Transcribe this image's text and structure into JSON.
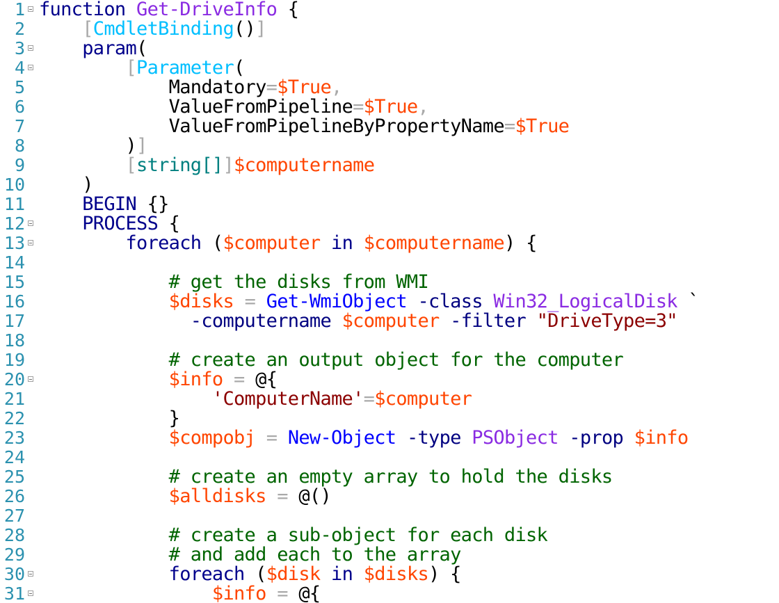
{
  "editor": {
    "language": "PowerShell",
    "token_colors": {
      "keyword": "#00008b",
      "function": "#8a2be2",
      "attribute": "#00bfff",
      "type": "#008080",
      "variable": "#ff4500",
      "operator": "#a9a9a9",
      "param": "#000080",
      "command": "#0000ff",
      "comment": "#006400",
      "string": "#8b0000",
      "text": "#000000",
      "line_number": "#2b91af"
    },
    "lines": [
      {
        "num": "1",
        "fold": true,
        "tokens": [
          {
            "t": "keyword",
            "v": "function"
          },
          {
            "t": "text",
            "v": " "
          },
          {
            "t": "function",
            "v": "Get-DriveInfo"
          },
          {
            "t": "text",
            "v": " {"
          }
        ]
      },
      {
        "num": "2",
        "fold": false,
        "tokens": [
          {
            "t": "text",
            "v": "    "
          },
          {
            "t": "operator",
            "v": "["
          },
          {
            "t": "attribute",
            "v": "CmdletBinding"
          },
          {
            "t": "text",
            "v": "()"
          },
          {
            "t": "operator",
            "v": "]"
          }
        ]
      },
      {
        "num": "3",
        "fold": true,
        "tokens": [
          {
            "t": "text",
            "v": "    "
          },
          {
            "t": "keyword",
            "v": "param"
          },
          {
            "t": "text",
            "v": "("
          }
        ]
      },
      {
        "num": "4",
        "fold": true,
        "tokens": [
          {
            "t": "text",
            "v": "        "
          },
          {
            "t": "operator",
            "v": "["
          },
          {
            "t": "attribute",
            "v": "Parameter"
          },
          {
            "t": "text",
            "v": "("
          }
        ]
      },
      {
        "num": "5",
        "fold": false,
        "tokens": [
          {
            "t": "text",
            "v": "            Mandatory"
          },
          {
            "t": "operator",
            "v": "="
          },
          {
            "t": "variable",
            "v": "$True"
          },
          {
            "t": "operator",
            "v": ","
          }
        ]
      },
      {
        "num": "6",
        "fold": false,
        "tokens": [
          {
            "t": "text",
            "v": "            ValueFromPipeline"
          },
          {
            "t": "operator",
            "v": "="
          },
          {
            "t": "variable",
            "v": "$True"
          },
          {
            "t": "operator",
            "v": ","
          }
        ]
      },
      {
        "num": "7",
        "fold": false,
        "tokens": [
          {
            "t": "text",
            "v": "            ValueFromPipelineByPropertyName"
          },
          {
            "t": "operator",
            "v": "="
          },
          {
            "t": "variable",
            "v": "$True"
          }
        ]
      },
      {
        "num": "8",
        "fold": false,
        "tokens": [
          {
            "t": "text",
            "v": "        )"
          },
          {
            "t": "operator",
            "v": "]"
          }
        ]
      },
      {
        "num": "9",
        "fold": false,
        "tokens": [
          {
            "t": "text",
            "v": "        "
          },
          {
            "t": "operator",
            "v": "["
          },
          {
            "t": "type",
            "v": "string[]"
          },
          {
            "t": "operator",
            "v": "]"
          },
          {
            "t": "variable",
            "v": "$computername"
          }
        ]
      },
      {
        "num": "10",
        "fold": false,
        "tokens": [
          {
            "t": "text",
            "v": "    )"
          }
        ]
      },
      {
        "num": "11",
        "fold": false,
        "tokens": [
          {
            "t": "text",
            "v": "    "
          },
          {
            "t": "keyword",
            "v": "BEGIN"
          },
          {
            "t": "text",
            "v": " {}"
          }
        ]
      },
      {
        "num": "12",
        "fold": true,
        "tokens": [
          {
            "t": "text",
            "v": "    "
          },
          {
            "t": "keyword",
            "v": "PROCESS"
          },
          {
            "t": "text",
            "v": " {"
          }
        ]
      },
      {
        "num": "13",
        "fold": true,
        "tokens": [
          {
            "t": "text",
            "v": "        "
          },
          {
            "t": "keyword",
            "v": "foreach"
          },
          {
            "t": "text",
            "v": " ("
          },
          {
            "t": "variable",
            "v": "$computer"
          },
          {
            "t": "text",
            "v": " "
          },
          {
            "t": "keyword",
            "v": "in"
          },
          {
            "t": "text",
            "v": " "
          },
          {
            "t": "variable",
            "v": "$computername"
          },
          {
            "t": "text",
            "v": ") {"
          }
        ]
      },
      {
        "num": "14",
        "fold": false,
        "tokens": []
      },
      {
        "num": "15",
        "fold": false,
        "tokens": [
          {
            "t": "text",
            "v": "            "
          },
          {
            "t": "comment",
            "v": "# get the disks from WMI"
          }
        ]
      },
      {
        "num": "16",
        "fold": false,
        "tokens": [
          {
            "t": "text",
            "v": "            "
          },
          {
            "t": "variable",
            "v": "$disks"
          },
          {
            "t": "text",
            "v": " "
          },
          {
            "t": "operator",
            "v": "="
          },
          {
            "t": "text",
            "v": " "
          },
          {
            "t": "command",
            "v": "Get-WmiObject"
          },
          {
            "t": "text",
            "v": " "
          },
          {
            "t": "param",
            "v": "-class"
          },
          {
            "t": "text",
            "v": " "
          },
          {
            "t": "function",
            "v": "Win32_LogicalDisk"
          },
          {
            "t": "text",
            "v": " `"
          }
        ]
      },
      {
        "num": "17",
        "fold": false,
        "tokens": [
          {
            "t": "text",
            "v": "              "
          },
          {
            "t": "param",
            "v": "-computername"
          },
          {
            "t": "text",
            "v": " "
          },
          {
            "t": "variable",
            "v": "$computer"
          },
          {
            "t": "text",
            "v": " "
          },
          {
            "t": "param",
            "v": "-filter"
          },
          {
            "t": "text",
            "v": " "
          },
          {
            "t": "string",
            "v": "\"DriveType=3\""
          }
        ]
      },
      {
        "num": "18",
        "fold": false,
        "tokens": []
      },
      {
        "num": "19",
        "fold": false,
        "tokens": [
          {
            "t": "text",
            "v": "            "
          },
          {
            "t": "comment",
            "v": "# create an output object for the computer"
          }
        ]
      },
      {
        "num": "20",
        "fold": true,
        "tokens": [
          {
            "t": "text",
            "v": "            "
          },
          {
            "t": "variable",
            "v": "$info"
          },
          {
            "t": "text",
            "v": " "
          },
          {
            "t": "operator",
            "v": "="
          },
          {
            "t": "text",
            "v": " @{"
          }
        ]
      },
      {
        "num": "21",
        "fold": false,
        "tokens": [
          {
            "t": "text",
            "v": "                "
          },
          {
            "t": "string",
            "v": "'ComputerName'"
          },
          {
            "t": "operator",
            "v": "="
          },
          {
            "t": "variable",
            "v": "$computer"
          }
        ]
      },
      {
        "num": "22",
        "fold": false,
        "tokens": [
          {
            "t": "text",
            "v": "            }"
          }
        ]
      },
      {
        "num": "23",
        "fold": false,
        "tokens": [
          {
            "t": "text",
            "v": "            "
          },
          {
            "t": "variable",
            "v": "$compobj"
          },
          {
            "t": "text",
            "v": " "
          },
          {
            "t": "operator",
            "v": "="
          },
          {
            "t": "text",
            "v": " "
          },
          {
            "t": "command",
            "v": "New-Object"
          },
          {
            "t": "text",
            "v": " "
          },
          {
            "t": "param",
            "v": "-type"
          },
          {
            "t": "text",
            "v": " "
          },
          {
            "t": "function",
            "v": "PSObject"
          },
          {
            "t": "text",
            "v": " "
          },
          {
            "t": "param",
            "v": "-prop"
          },
          {
            "t": "text",
            "v": " "
          },
          {
            "t": "variable",
            "v": "$info"
          }
        ]
      },
      {
        "num": "24",
        "fold": false,
        "tokens": []
      },
      {
        "num": "25",
        "fold": false,
        "tokens": [
          {
            "t": "text",
            "v": "            "
          },
          {
            "t": "comment",
            "v": "# create an empty array to hold the disks"
          }
        ]
      },
      {
        "num": "26",
        "fold": false,
        "tokens": [
          {
            "t": "text",
            "v": "            "
          },
          {
            "t": "variable",
            "v": "$alldisks"
          },
          {
            "t": "text",
            "v": " "
          },
          {
            "t": "operator",
            "v": "="
          },
          {
            "t": "text",
            "v": " @()"
          }
        ]
      },
      {
        "num": "27",
        "fold": false,
        "tokens": []
      },
      {
        "num": "28",
        "fold": false,
        "tokens": [
          {
            "t": "text",
            "v": "            "
          },
          {
            "t": "comment",
            "v": "# create a sub-object for each disk"
          }
        ]
      },
      {
        "num": "29",
        "fold": false,
        "tokens": [
          {
            "t": "text",
            "v": "            "
          },
          {
            "t": "comment",
            "v": "# and add each to the array"
          }
        ]
      },
      {
        "num": "30",
        "fold": true,
        "tokens": [
          {
            "t": "text",
            "v": "            "
          },
          {
            "t": "keyword",
            "v": "foreach"
          },
          {
            "t": "text",
            "v": " ("
          },
          {
            "t": "variable",
            "v": "$disk"
          },
          {
            "t": "text",
            "v": " "
          },
          {
            "t": "keyword",
            "v": "in"
          },
          {
            "t": "text",
            "v": " "
          },
          {
            "t": "variable",
            "v": "$disks"
          },
          {
            "t": "text",
            "v": ") {"
          }
        ]
      },
      {
        "num": "31",
        "fold": true,
        "tokens": [
          {
            "t": "text",
            "v": "                "
          },
          {
            "t": "variable",
            "v": "$info"
          },
          {
            "t": "text",
            "v": " "
          },
          {
            "t": "operator",
            "v": "="
          },
          {
            "t": "text",
            "v": " @{"
          }
        ]
      }
    ]
  }
}
